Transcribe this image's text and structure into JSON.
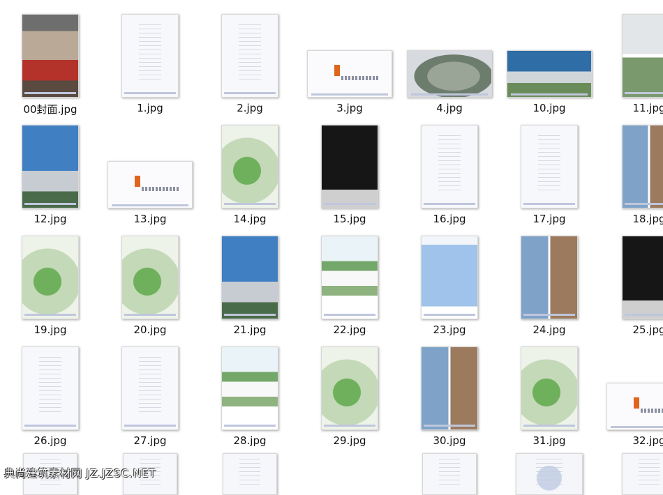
{
  "files": [
    "00封面.jpg",
    "1.jpg",
    "2.jpg",
    "3.jpg",
    "4.jpg",
    "10.jpg",
    "11.jpg",
    "12.jpg",
    "13.jpg",
    "14.jpg",
    "15.jpg",
    "16.jpg",
    "17.jpg",
    "18.jpg",
    "19.jpg",
    "20.jpg",
    "21.jpg",
    "22.jpg",
    "23.jpg",
    "24.jpg",
    "25.jpg",
    "26.jpg",
    "27.jpg",
    "28.jpg",
    "29.jpg",
    "30.jpg",
    "31.jpg",
    "32.jpg"
  ],
  "watermark": "典尚建筑素材网 JZ.JZSC.NET"
}
